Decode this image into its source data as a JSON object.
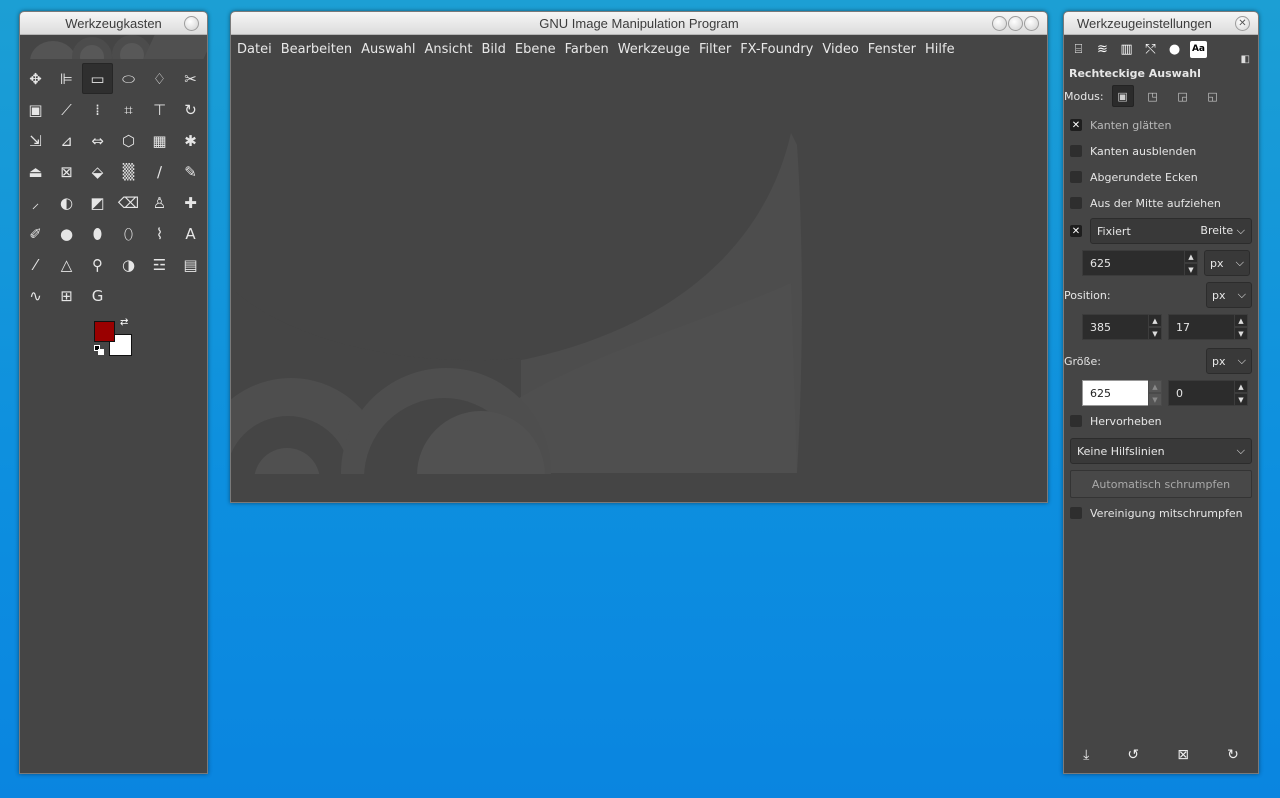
{
  "toolbox": {
    "title": "Werkzeugkasten",
    "tools": [
      {
        "name": "move-tool-icon",
        "glyph": "✥"
      },
      {
        "name": "align-tool-icon",
        "glyph": "⊫"
      },
      {
        "name": "rect-select-tool-icon",
        "glyph": "▭"
      },
      {
        "name": "ellipse-select-tool-icon",
        "glyph": "⬭"
      },
      {
        "name": "free-select-tool-icon",
        "glyph": "♢"
      },
      {
        "name": "scissors-select-tool-icon",
        "glyph": "✂"
      },
      {
        "name": "foreground-select-tool-icon",
        "glyph": "▣"
      },
      {
        "name": "fuzzy-select-tool-icon",
        "glyph": "⟋"
      },
      {
        "name": "select-by-color-tool-icon",
        "glyph": "⁞"
      },
      {
        "name": "crop-tool-icon",
        "glyph": "⌗"
      },
      {
        "name": "unified-transform-tool-icon",
        "glyph": "⊤"
      },
      {
        "name": "rotate-tool-icon",
        "glyph": "↻"
      },
      {
        "name": "scale-tool-icon",
        "glyph": "⇲"
      },
      {
        "name": "shear-tool-icon",
        "glyph": "⊿"
      },
      {
        "name": "flip-tool-icon",
        "glyph": "⇔"
      },
      {
        "name": "perspective-tool-icon",
        "glyph": "⬡"
      },
      {
        "name": "cage-tool-icon",
        "glyph": "▦"
      },
      {
        "name": "warp-tool-icon",
        "glyph": "✱"
      },
      {
        "name": "handle-transform-tool-icon",
        "glyph": "⏏"
      },
      {
        "name": "3d-transform-tool-icon",
        "glyph": "⊠"
      },
      {
        "name": "bucket-fill-tool-icon",
        "glyph": "⬙"
      },
      {
        "name": "gradient-tool-icon",
        "glyph": "▒"
      },
      {
        "name": "paintbrush-tool-icon",
        "glyph": "∕"
      },
      {
        "name": "pencil-tool-icon",
        "glyph": "✎"
      },
      {
        "name": "airbrush-tool-icon",
        "glyph": "⸝"
      },
      {
        "name": "ink-tool-icon",
        "glyph": "◐"
      },
      {
        "name": "mypaint-brush-tool-icon",
        "glyph": "◩"
      },
      {
        "name": "eraser-tool-icon",
        "glyph": "⌫"
      },
      {
        "name": "clone-tool-icon",
        "glyph": "♙"
      },
      {
        "name": "heal-tool-icon",
        "glyph": "✚"
      },
      {
        "name": "perspective-clone-tool-icon",
        "glyph": "✐"
      },
      {
        "name": "smudge-tool-icon",
        "glyph": "●"
      },
      {
        "name": "blur-tool-icon",
        "glyph": "⬮"
      },
      {
        "name": "dodge-burn-tool-icon",
        "glyph": "⬯"
      },
      {
        "name": "paths-tool-icon",
        "glyph": "⌇"
      },
      {
        "name": "text-tool-icon",
        "glyph": "A"
      },
      {
        "name": "color-picker-tool-icon",
        "glyph": "⁄"
      },
      {
        "name": "measure-tool-icon",
        "glyph": "△"
      },
      {
        "name": "zoom-tool-icon",
        "glyph": "⚲"
      },
      {
        "name": "threshold-tool-icon",
        "glyph": "◑"
      },
      {
        "name": "levels-tool-icon",
        "glyph": "☲"
      },
      {
        "name": "histogram-tool-icon",
        "glyph": "▤"
      },
      {
        "name": "curves-tool-icon",
        "glyph": "∿"
      },
      {
        "name": "offset-tool-icon",
        "glyph": "⊞"
      },
      {
        "name": "gmic-tool-icon",
        "glyph": "G"
      }
    ],
    "fg_color": "#9a0000",
    "bg_color": "#ffffff"
  },
  "main": {
    "title": "GNU Image Manipulation Program",
    "menu": [
      "Datei",
      "Bearbeiten",
      "Auswahl",
      "Ansicht",
      "Bild",
      "Ebene",
      "Farben",
      "Werkzeuge",
      "Filter",
      "FX-Foundry",
      "Video",
      "Fenster",
      "Hilfe"
    ]
  },
  "options": {
    "title": "Werkzeugeinstellungen",
    "heading": "Rechteckige Auswahl",
    "mode_label": "Modus:",
    "antialias": "Kanten glätten",
    "feather": "Kanten ausblenden",
    "rounded": "Abgerundete Ecken",
    "from_center": "Aus der Mitte aufziehen",
    "fixed_label": "Fixiert",
    "fixed_value": "Breite",
    "fixed_number": "625",
    "unit_px": "px",
    "position_label": "Position:",
    "pos_x": "385",
    "pos_y": "17",
    "size_label": "Größe:",
    "size_w": "625",
    "size_h": "0",
    "highlight": "Hervorheben",
    "guides": "Keine Hilfslinien",
    "autoshrink": "Automatisch schrumpfen",
    "shrink_merged": "Vereinigung mitschrumpfen"
  }
}
